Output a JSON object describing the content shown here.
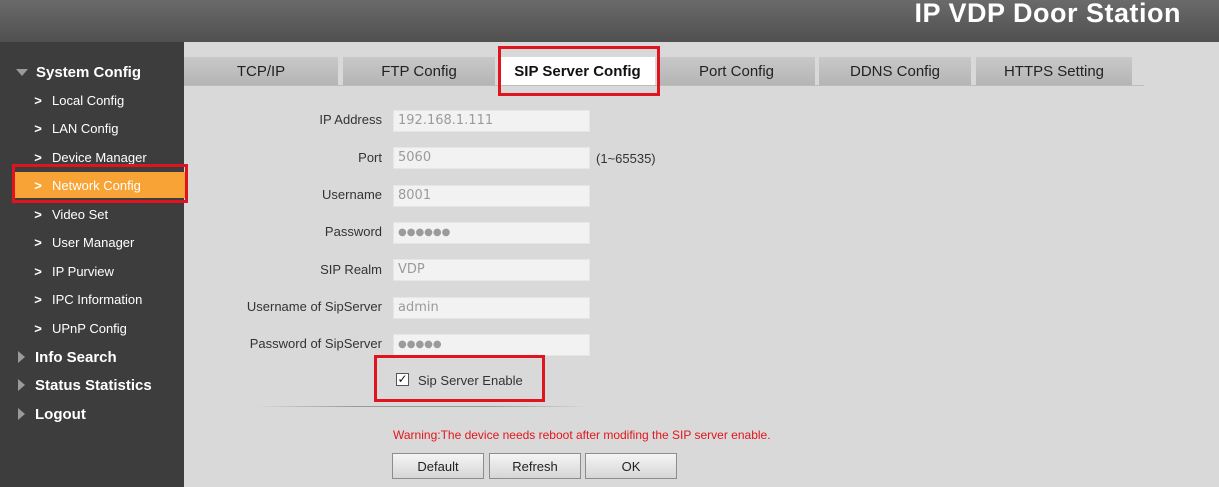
{
  "header": {
    "title": "IP VDP Door Station"
  },
  "sidebar": {
    "sections": [
      {
        "label": "System Config",
        "expanded": true
      },
      {
        "label": "Info Search",
        "expanded": false
      },
      {
        "label": "Status Statistics",
        "expanded": false
      },
      {
        "label": "Logout",
        "expanded": false
      }
    ],
    "items": [
      {
        "label": "Local Config"
      },
      {
        "label": "LAN Config"
      },
      {
        "label": "Device Manager"
      },
      {
        "label": "Network Config",
        "active": true
      },
      {
        "label": "Video Set"
      },
      {
        "label": "User Manager"
      },
      {
        "label": "IP Purview"
      },
      {
        "label": "IPC Information"
      },
      {
        "label": "UPnP Config"
      }
    ]
  },
  "tabs": [
    {
      "label": "TCP/IP"
    },
    {
      "label": "FTP Config"
    },
    {
      "label": "SIP Server Config",
      "active": true
    },
    {
      "label": "Port Config"
    },
    {
      "label": "DDNS Config"
    },
    {
      "label": "HTTPS Setting"
    }
  ],
  "form": {
    "ip_address": {
      "label": "IP Address",
      "value": "192.168.1.111"
    },
    "port": {
      "label": "Port",
      "value": "5060",
      "hint": "(1~65535)"
    },
    "username": {
      "label": "Username",
      "value": "8001"
    },
    "password": {
      "label": "Password",
      "value": "●●●●●●"
    },
    "sip_realm": {
      "label": "SIP Realm",
      "value": "VDP"
    },
    "sipserver_username": {
      "label": "Username of SipServer",
      "value": "admin"
    },
    "sipserver_password": {
      "label": "Password of SipServer",
      "value": "●●●●●"
    },
    "sip_enable": {
      "label": "Sip Server Enable",
      "checked": true,
      "mark": "✓"
    }
  },
  "warning": "Warning:The device needs reboot after modifing the SIP server enable.",
  "buttons": {
    "default": "Default",
    "refresh": "Refresh",
    "ok": "OK"
  },
  "colors": {
    "accent": "#f8a335",
    "highlight": "#e0141e",
    "warning": "#e2161c"
  }
}
